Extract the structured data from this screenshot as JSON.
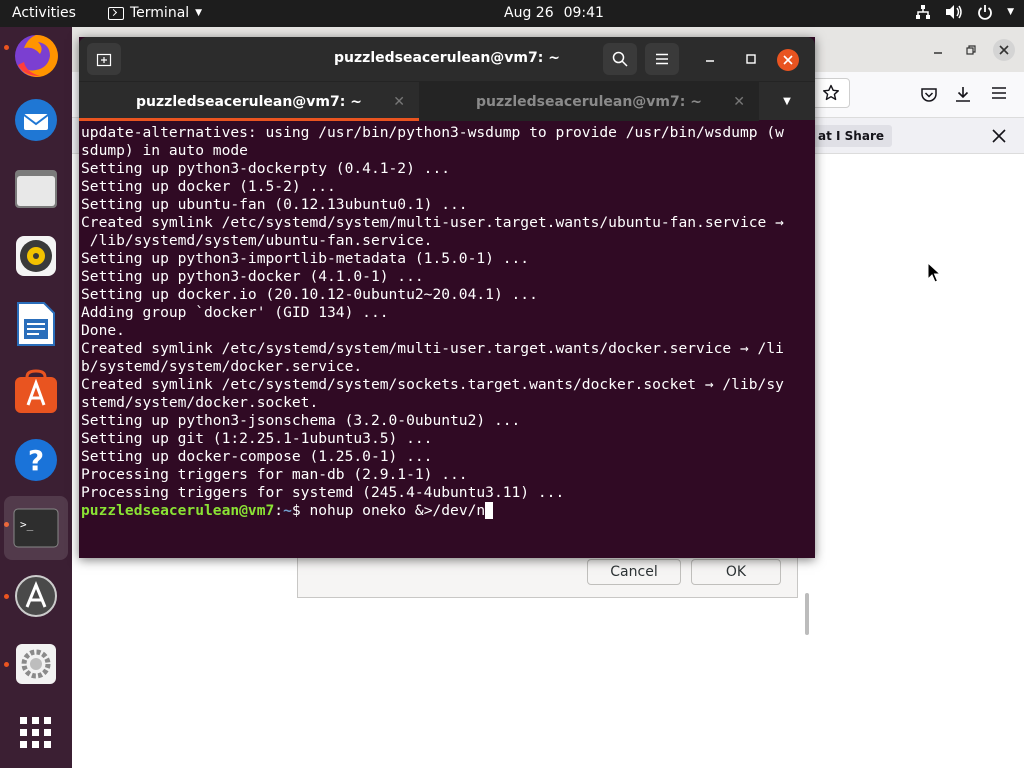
{
  "topbar": {
    "activities": "Activities",
    "app_menu_label": "Terminal",
    "date": "Aug 26",
    "time": "09:41",
    "tray_icons": [
      "network-icon",
      "volume-icon",
      "power-icon"
    ]
  },
  "dock": {
    "items": [
      {
        "name": "firefox-icon",
        "running": true
      },
      {
        "name": "thunderbird-icon",
        "running": false
      },
      {
        "name": "files-icon",
        "running": false
      },
      {
        "name": "rhythmbox-icon",
        "running": false
      },
      {
        "name": "libreoffice-writer-icon",
        "running": false
      },
      {
        "name": "ubuntu-software-icon",
        "running": false
      },
      {
        "name": "help-icon",
        "running": false
      },
      {
        "name": "terminal-icon",
        "running": true
      },
      {
        "name": "software-updater-icon",
        "running": true
      },
      {
        "name": "settings-icon",
        "running": true
      },
      {
        "name": "show-apps-icon",
        "running": false
      }
    ]
  },
  "browser": {
    "notification_pill": "at I Share"
  },
  "dialog": {
    "cancel_label": "Cancel",
    "ok_label": "OK"
  },
  "terminal": {
    "title": "puzzledseacerulean@vm7: ~",
    "tabs": [
      {
        "label": "puzzledseacerulean@vm7: ~",
        "active": true
      },
      {
        "label": "puzzledseacerulean@vm7: ~",
        "active": false
      }
    ],
    "output": "update-alternatives: using /usr/bin/python3-wsdump to provide /usr/bin/wsdump (w\nsdump) in auto mode\nSetting up python3-dockerpty (0.4.1-2) ...\nSetting up docker (1.5-2) ...\nSetting up ubuntu-fan (0.12.13ubuntu0.1) ...\nCreated symlink /etc/systemd/system/multi-user.target.wants/ubuntu-fan.service →\n /lib/systemd/system/ubuntu-fan.service.\nSetting up python3-importlib-metadata (1.5.0-1) ...\nSetting up python3-docker (4.1.0-1) ...\nSetting up docker.io (20.10.12-0ubuntu2~20.04.1) ...\nAdding group `docker' (GID 134) ...\nDone.\nCreated symlink /etc/systemd/system/multi-user.target.wants/docker.service → /li\nb/systemd/system/docker.service.\nCreated symlink /etc/systemd/system/sockets.target.wants/docker.socket → /lib/sy\nstemd/system/docker.socket.\nSetting up python3-jsonschema (3.2.0-0ubuntu2) ...\nSetting up git (1:2.25.1-1ubuntu3.5) ...\nSetting up docker-compose (1.25.0-1) ...\nProcessing triggers for man-db (2.9.1-1) ...\nProcessing triggers for systemd (245.4-4ubuntu3.11) ...",
    "prompt_user": "puzzledseacerulean@vm7",
    "prompt_sep": ":",
    "prompt_path": "~",
    "prompt_symbol": "$ ",
    "command": "nohup oneko &>/dev/n"
  },
  "colors": {
    "terminal_bg": "#300a24",
    "dock_bg": "#3b1f33",
    "accent": "#e95420",
    "close_button": "#e95420",
    "prompt_user": "#8ae234",
    "prompt_path": "#729fcf"
  }
}
